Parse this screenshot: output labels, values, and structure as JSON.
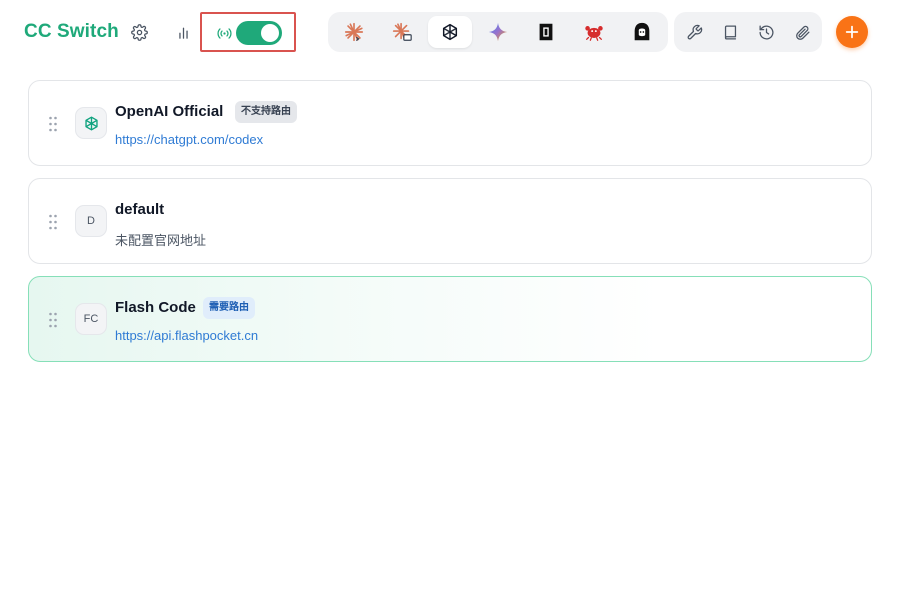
{
  "header": {
    "brand": "CC Switch",
    "icons": {
      "settings": "gear-icon",
      "usage": "bar-chart-icon",
      "proxy_signal": "signal-icon"
    },
    "proxy_toggle": {
      "state": "on"
    },
    "apps": [
      {
        "id": "claude",
        "icon": "claude-code-icon"
      },
      {
        "id": "claude-desktop",
        "icon": "claude-desktop-icon"
      },
      {
        "id": "codex",
        "icon": "openai-icon",
        "active": true
      },
      {
        "id": "gemini",
        "icon": "gemini-icon"
      },
      {
        "id": "opencode",
        "icon": "opencode-icon"
      },
      {
        "id": "crab",
        "icon": "crab-icon"
      },
      {
        "id": "qwen",
        "icon": "hooded-figure-icon"
      }
    ],
    "tools": [
      "wrench-icon",
      "book-icon",
      "history-icon",
      "paperclip-icon"
    ],
    "add_icon": "plus-icon"
  },
  "providers": [
    {
      "name": "OpenAI Official",
      "badge": "不支持路由",
      "url": "https://chatgpt.com/codex",
      "avatar": "openai-icon"
    },
    {
      "name": "default",
      "badge": "",
      "url": "未配置官网地址",
      "avatar": "D"
    },
    {
      "name": "Flash Code",
      "badge": "需要路由",
      "url": "https://api.flashpocket.cn",
      "avatar": "FC",
      "active": true
    }
  ],
  "colors": {
    "brand": "#1fa97a",
    "toggle_on": "#1fa97a",
    "add_button": "#f97316",
    "link": "#2f7bd4",
    "highlight_border": "#d9534f",
    "active_card_border": "#86dfb8"
  }
}
